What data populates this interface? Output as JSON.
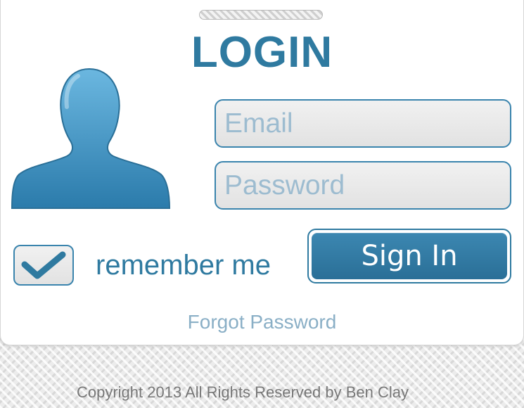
{
  "login": {
    "title": "LOGIN",
    "email": {
      "placeholder": "Email",
      "value": ""
    },
    "password": {
      "placeholder": "Password",
      "value": ""
    },
    "remember_me": {
      "label": "remember me",
      "checked": true
    },
    "sign_in_label": "Sign In",
    "forgot_password_label": "Forgot Password"
  },
  "footer": {
    "copyright": "Copyright 2013 All Rights Reserved by Ben Clay"
  },
  "icons": {
    "avatar": "user-silhouette-icon",
    "checkbox_mark": "checkmark-icon"
  },
  "colors": {
    "accent": "#2f7aa0",
    "button_top": "#3c87b1",
    "button_bottom": "#2a6f97",
    "placeholder": "#9dbcd0",
    "field_bg": "#e8e8e8",
    "copyright_text": "#777777"
  }
}
